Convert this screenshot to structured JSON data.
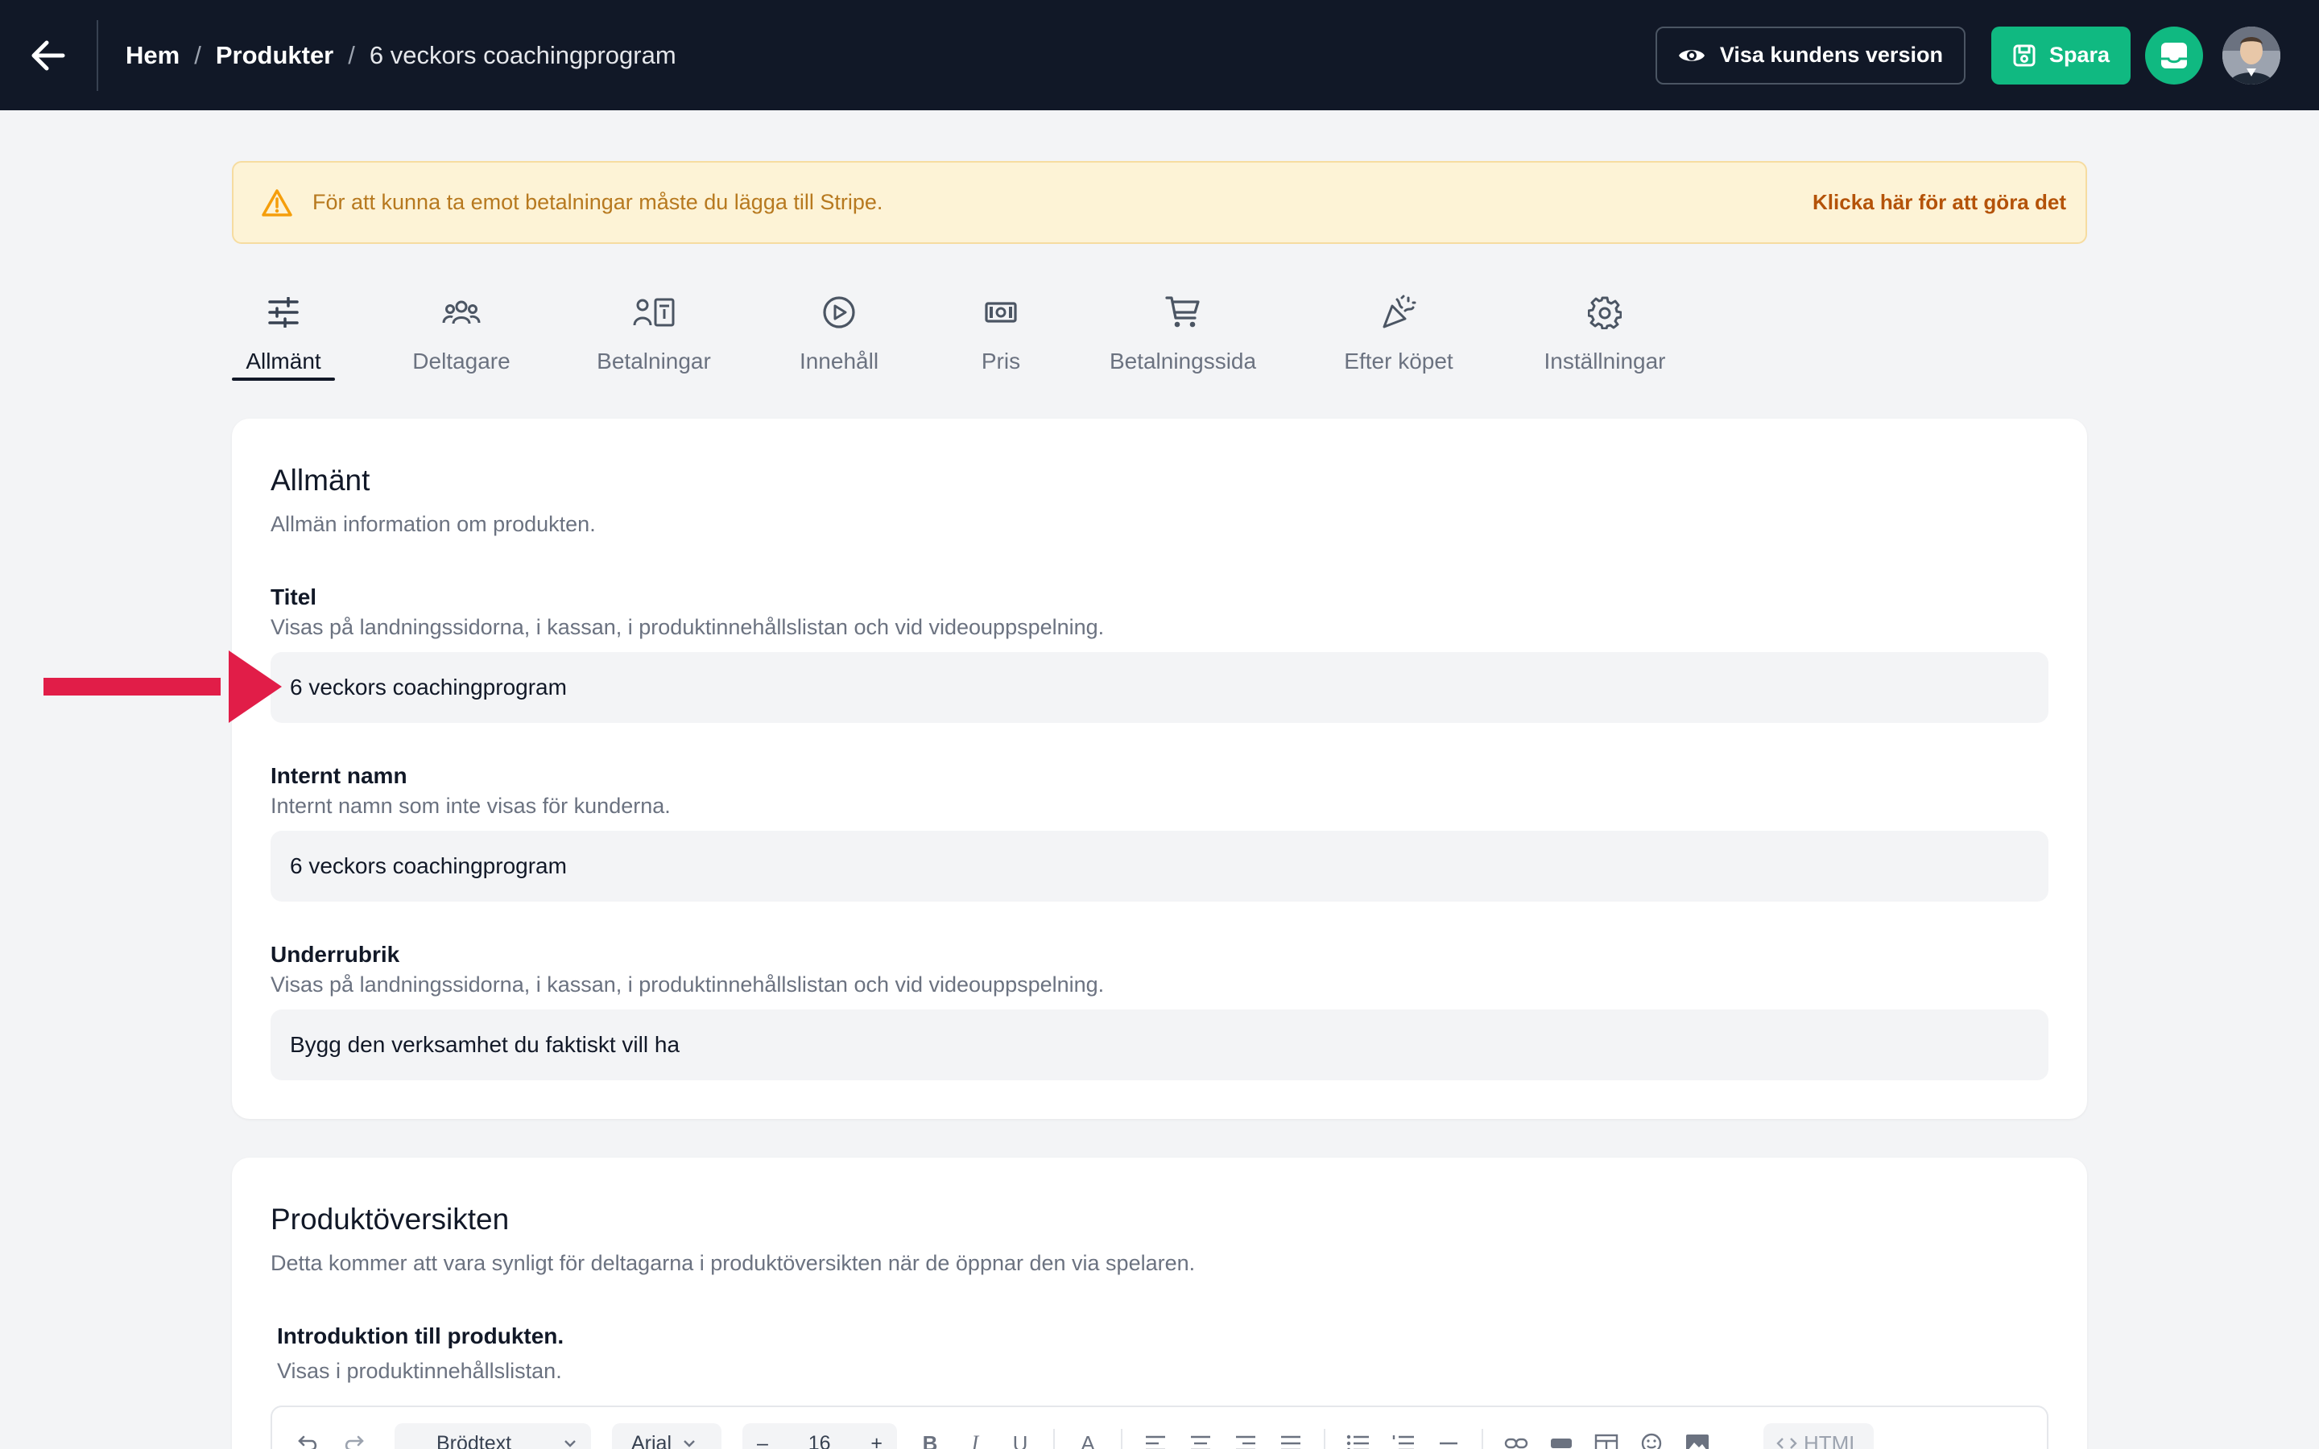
{
  "topbar": {
    "back_icon": "arrow-left-icon",
    "breadcrumb": [
      {
        "label": "Hem"
      },
      {
        "label": "Produkter"
      },
      {
        "label": "6 veckors coachingprogram"
      }
    ],
    "separator": "/",
    "preview_label": "Visa kundens version",
    "save_label": "Spara",
    "colors": {
      "bar": "#111827",
      "accent": "#10b981"
    }
  },
  "alert": {
    "text": "För att kunna ta emot betalningar måste du lägga till Stripe.",
    "link": "Klicka här för att göra det",
    "icon": "warning-triangle-icon"
  },
  "tabs": [
    {
      "label": "Allmänt",
      "icon": "sliders-icon",
      "active": true
    },
    {
      "label": "Deltagare",
      "icon": "users-icon",
      "active": false
    },
    {
      "label": "Betalningar",
      "icon": "payments-icon",
      "active": false
    },
    {
      "label": "Innehåll",
      "icon": "play-circle-icon",
      "active": false
    },
    {
      "label": "Pris",
      "icon": "banknote-icon",
      "active": false
    },
    {
      "label": "Betalningssida",
      "icon": "cart-icon",
      "active": false
    },
    {
      "label": "Efter köpet",
      "icon": "party-popper-icon",
      "active": false
    },
    {
      "label": "Inställningar",
      "icon": "gear-icon",
      "active": false
    }
  ],
  "general": {
    "title": "Allmänt",
    "description": "Allmän information om produkten.",
    "fields": [
      {
        "label": "Titel",
        "help": "Visas på landningssidorna, i kassan, i produktinnehållslistan och vid videouppspelning.",
        "value": "6 veckors coachingprogram"
      },
      {
        "label": "Internt namn",
        "help": "Internt namn som inte visas för kunderna.",
        "value": "6 veckors coachingprogram"
      },
      {
        "label": "Underrubrik",
        "help": "Visas på landningssidorna, i kassan, i produktinnehållslistan och vid videouppspelning.",
        "value": "Bygg den verksamhet du faktiskt vill ha"
      }
    ]
  },
  "overview": {
    "title": "Produktöversikten",
    "description": "Detta kommer att vara synligt för deltagarna i produktöversikten när de öppnar den via spelaren.",
    "intro_label": "Introduktion till produkten.",
    "intro_help": "Visas i produktinnehållslistan.",
    "toolbar": {
      "block_style": "Brödtext",
      "font": "Arial",
      "font_size": "16",
      "minus": "–",
      "plus": "+",
      "bold": "B",
      "italic": "I",
      "underline": "U",
      "color": "A",
      "html_label": "HTML"
    }
  }
}
